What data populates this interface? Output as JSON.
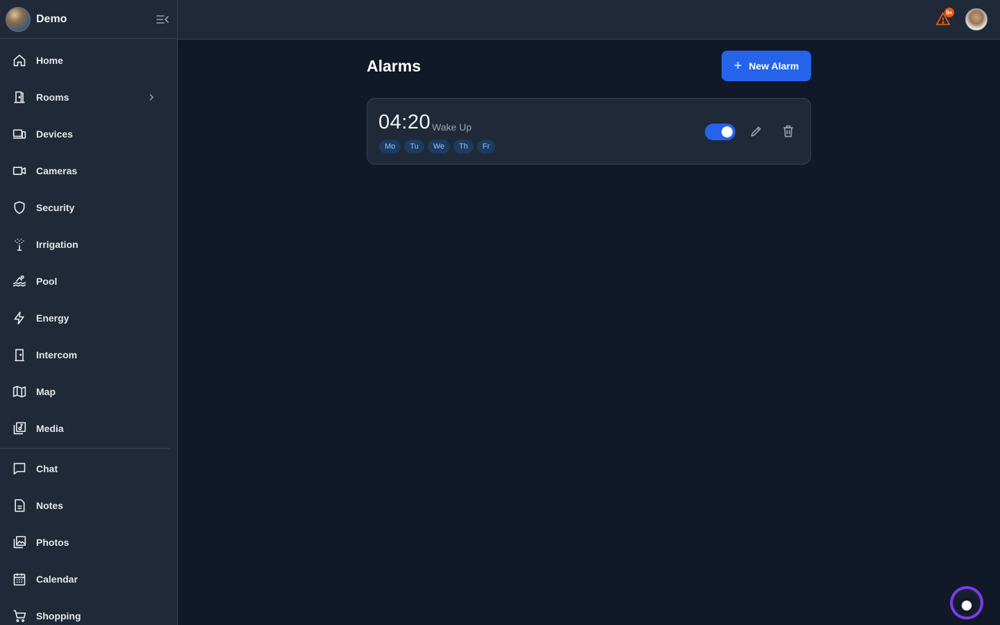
{
  "brand": {
    "name": "Demo"
  },
  "sidebar": {
    "items": [
      {
        "label": "Home",
        "icon": "home-icon"
      },
      {
        "label": "Rooms",
        "icon": "door-icon",
        "has_submenu": true
      },
      {
        "label": "Devices",
        "icon": "devices-icon"
      },
      {
        "label": "Cameras",
        "icon": "camera-icon"
      },
      {
        "label": "Security",
        "icon": "shield-icon"
      },
      {
        "label": "Irrigation",
        "icon": "sprinkler-icon"
      },
      {
        "label": "Pool",
        "icon": "pool-icon"
      },
      {
        "label": "Energy",
        "icon": "bolt-icon"
      },
      {
        "label": "Intercom",
        "icon": "intercom-icon"
      },
      {
        "label": "Map",
        "icon": "map-icon"
      },
      {
        "label": "Media",
        "icon": "media-icon"
      }
    ],
    "items2": [
      {
        "label": "Chat",
        "icon": "chat-icon"
      },
      {
        "label": "Notes",
        "icon": "notes-icon"
      },
      {
        "label": "Photos",
        "icon": "photos-icon"
      },
      {
        "label": "Calendar",
        "icon": "calendar-icon"
      },
      {
        "label": "Shopping",
        "icon": "cart-icon"
      }
    ]
  },
  "topbar": {
    "alert_badge": "9+"
  },
  "main": {
    "title": "Alarms",
    "new_alarm_label": "New Alarm",
    "alarms": [
      {
        "time": "04:20",
        "label": "Wake Up",
        "days": [
          "Mo",
          "Tu",
          "We",
          "Th",
          "Fr"
        ],
        "enabled": true
      }
    ]
  },
  "colors": {
    "background": "#111827",
    "surface": "#1f2937",
    "accent": "#2563eb",
    "alert": "#ea580c"
  }
}
